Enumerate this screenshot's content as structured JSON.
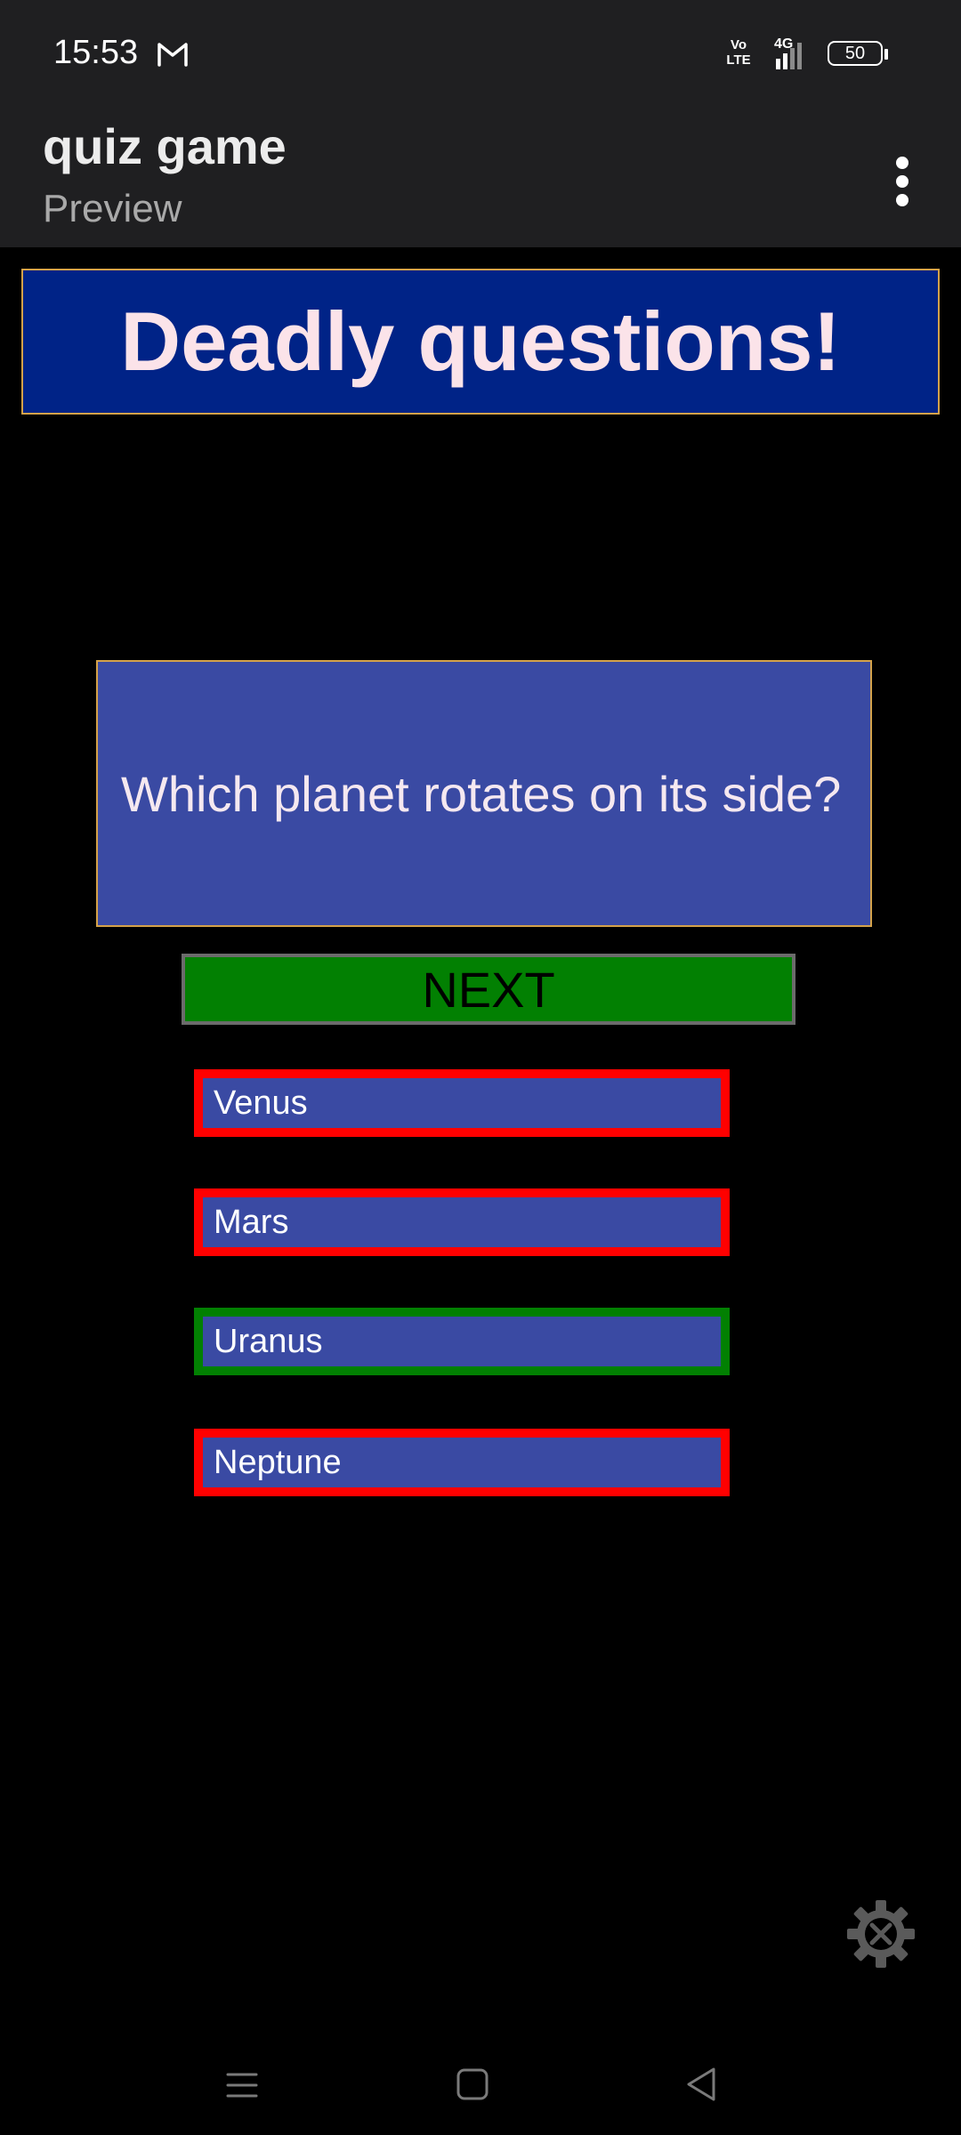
{
  "status_bar": {
    "time": "15:53",
    "gmail_icon": "gmail-icon",
    "volte_line1": "Vo",
    "volte_line2": "LTE",
    "network": "4G",
    "battery": "50"
  },
  "app_bar": {
    "title": "quiz game",
    "subtitle": "Preview",
    "menu_icon": "more-vertical-icon"
  },
  "banner": {
    "text": "Deadly questions!"
  },
  "question": {
    "text": "Which planet rotates on its side?"
  },
  "next_button": {
    "label": "NEXT"
  },
  "answers": [
    {
      "label": "Venus",
      "state": "wrong"
    },
    {
      "label": "Mars",
      "state": "wrong"
    },
    {
      "label": "Uranus",
      "state": "correct"
    },
    {
      "label": "Neptune",
      "state": "wrong"
    }
  ],
  "colors": {
    "banner_bg": "#002387",
    "banner_text": "#fbe3e9",
    "question_bg": "#3a4aa3",
    "accent_border": "#d4a24a",
    "next_bg": "#028002",
    "wrong_border": "#ff0000",
    "correct_border": "#028002"
  },
  "icons": {
    "settings": "settings-gear-icon",
    "nav_menu": "menu-icon",
    "nav_home": "home-icon",
    "nav_back": "back-icon"
  }
}
